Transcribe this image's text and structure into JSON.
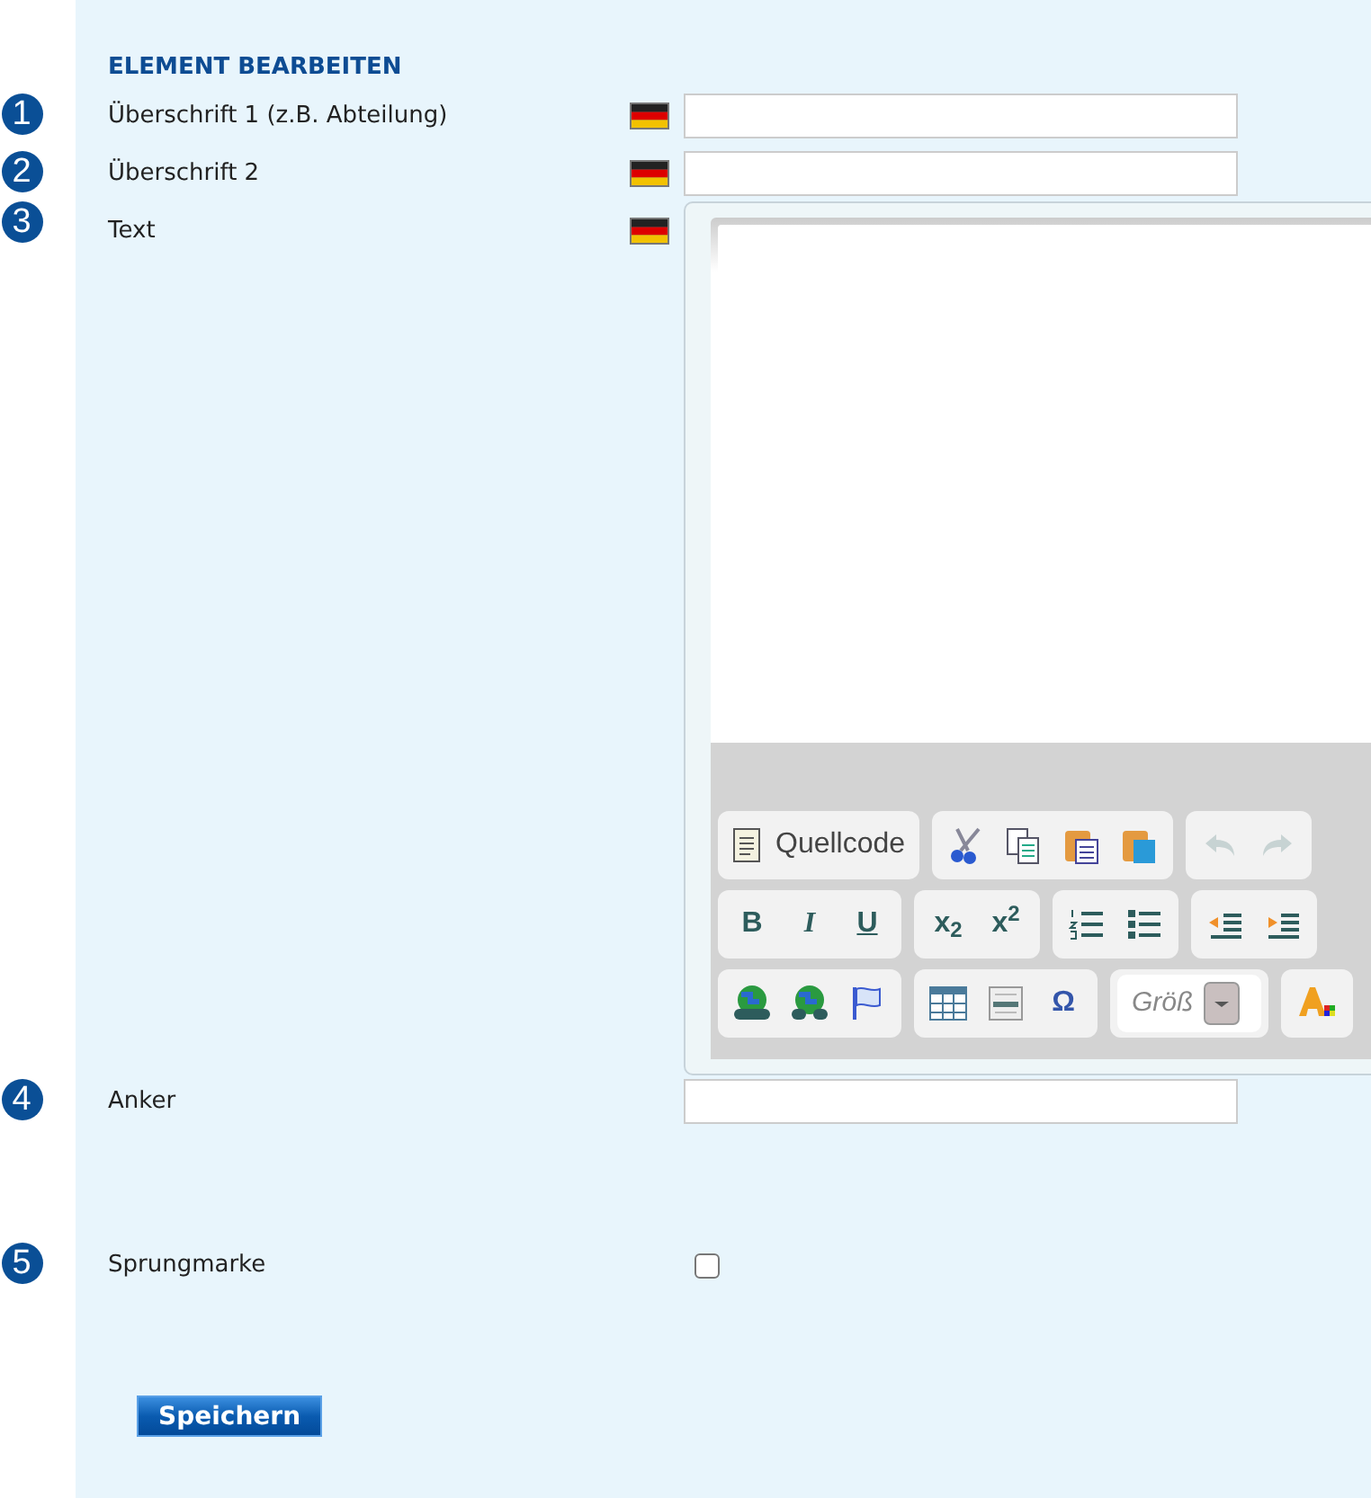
{
  "title": "ELEMENT BEARBEITEN",
  "fields": [
    {
      "number": "1",
      "label": "Überschrift 1 (z.B. Abteilung)",
      "kind": "input",
      "flag": true
    },
    {
      "number": "2",
      "label": "Überschrift 2",
      "kind": "input",
      "flag": true
    },
    {
      "number": "3",
      "label": "Text",
      "kind": "editor",
      "flag": true
    },
    {
      "number": "4",
      "label": "Anker",
      "kind": "input",
      "flag": false
    },
    {
      "number": "5",
      "label": "Sprungmarke",
      "kind": "checkbox",
      "flag": false,
      "checked": false
    }
  ],
  "toolbar": [
    [
      [
        {
          "kind": "source",
          "label": "Quellcode",
          "disabled": false
        }
      ],
      [
        {
          "kind": "cut",
          "disabled": false
        },
        {
          "kind": "copy",
          "disabled": false
        },
        {
          "kind": "paste",
          "disabled": false
        },
        {
          "kind": "pasteword",
          "disabled": false
        }
      ],
      [
        {
          "kind": "undo",
          "disabled": true
        },
        {
          "kind": "redo",
          "disabled": true
        }
      ]
    ],
    [
      [
        {
          "kind": "bold",
          "label": "B",
          "disabled": false
        },
        {
          "kind": "italic",
          "label": "I",
          "disabled": false
        },
        {
          "kind": "underline",
          "label": "U",
          "disabled": false
        }
      ],
      [
        {
          "kind": "script",
          "label": "x$_{2}$",
          "disabled": false
        },
        {
          "kind": "script",
          "label": "x$^{2}$",
          "disabled": false
        }
      ],
      [
        {
          "kind": "numlist",
          "disabled": false
        },
        {
          "kind": "bullist",
          "disabled": false
        }
      ],
      [
        {
          "kind": "outdent",
          "disabled": false
        },
        {
          "kind": "indent",
          "disabled": false
        }
      ]
    ],
    [
      [
        {
          "kind": "link",
          "disabled": false
        },
        {
          "kind": "unlink",
          "disabled": false
        },
        {
          "kind": "anchor",
          "disabled": false
        }
      ],
      [
        {
          "kind": "table",
          "disabled": false
        },
        {
          "kind": "hr",
          "disabled": false
        },
        {
          "kind": "symbol",
          "label": "Ω",
          "disabled": false
        }
      ],
      [
        {
          "kind": "combo",
          "label": "Größ"
        }
      ],
      [
        {
          "kind": "textcolor",
          "disabled": false
        }
      ]
    ]
  ],
  "save_button": "Speichern"
}
